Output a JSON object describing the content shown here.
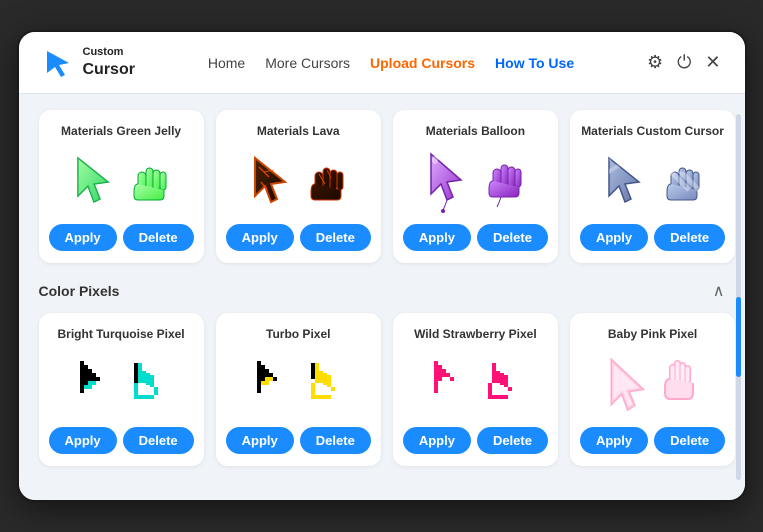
{
  "window": {
    "title": "Custom Cursor"
  },
  "nav": {
    "home": "Home",
    "more_cursors": "More Cursors",
    "upload_cursors": "Upload Cursors",
    "how_to_use": "How To Use"
  },
  "sections": [
    {
      "id": "materials",
      "label": "",
      "cards": [
        {
          "id": "green-jelly",
          "title": "Materials Green Jelly",
          "apply_label": "Apply",
          "delete_label": "Delete",
          "colors": [
            "#44ff44",
            "#22cc44"
          ]
        },
        {
          "id": "lava",
          "title": "Materials Lava",
          "apply_label": "Apply",
          "delete_label": "Delete",
          "colors": [
            "#3a1a1a",
            "#cc3300"
          ]
        },
        {
          "id": "balloon",
          "title": "Materials Balloon",
          "apply_label": "Apply",
          "delete_label": "Delete",
          "colors": [
            "#cc88ff",
            "#9933cc"
          ]
        },
        {
          "id": "custom-cursor",
          "title": "Materials Custom Cursor",
          "apply_label": "Apply",
          "delete_label": "Delete",
          "colors": [
            "#8899cc",
            "#aabbdd"
          ]
        }
      ]
    },
    {
      "id": "color-pixels",
      "label": "Color Pixels",
      "cards": [
        {
          "id": "turquoise-pixel",
          "title": "Bright Turquoise Pixel",
          "apply_label": "Apply",
          "delete_label": "Delete",
          "colors": [
            "#00ddcc",
            "#000000"
          ]
        },
        {
          "id": "turbo-pixel",
          "title": "Turbo Pixel",
          "apply_label": "Apply",
          "delete_label": "Delete",
          "colors": [
            "#ffdd00",
            "#000000"
          ]
        },
        {
          "id": "strawberry-pixel",
          "title": "Wild Strawberry Pixel",
          "apply_label": "Apply",
          "delete_label": "Delete",
          "colors": [
            "#ff1177",
            "#000000"
          ]
        },
        {
          "id": "baby-pink-pixel",
          "title": "Baby Pink Pixel",
          "apply_label": "Apply",
          "delete_label": "Delete",
          "colors": [
            "#ffaacc",
            "#ff88aa"
          ]
        }
      ]
    }
  ],
  "icons": {
    "settings": "⚙",
    "power": "⏻",
    "close": "✕",
    "chevron_up": "∧"
  }
}
